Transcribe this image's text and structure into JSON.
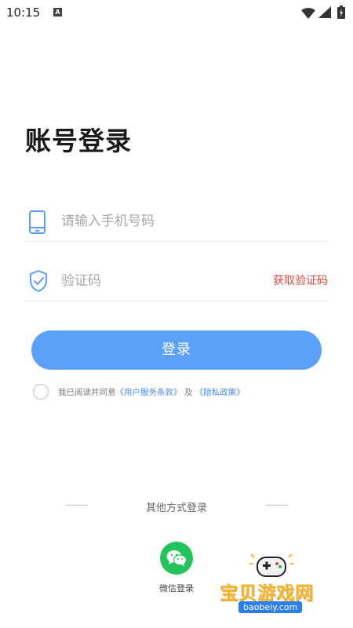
{
  "status_bar": {
    "time": "10:15",
    "notification_icon": "a-letter-icon",
    "icons": [
      "wifi-icon",
      "signal-icon",
      "battery-icon"
    ]
  },
  "page": {
    "title": "账号登录"
  },
  "phone_field": {
    "icon": "phone-icon",
    "placeholder": "请输入手机号码",
    "value": ""
  },
  "code_field": {
    "icon": "shield-check-icon",
    "placeholder": "验证码",
    "value": "",
    "get_code_label": "获取验证码"
  },
  "login_button": {
    "label": "登录"
  },
  "agreement": {
    "checked": false,
    "prefix": "我已阅读并同意",
    "terms_link": "《用户服务条款》",
    "conjunction": "及",
    "privacy_link": "《隐私政策》"
  },
  "other_login": {
    "label": "其他方式登录",
    "wechat_label": "微信登录"
  },
  "watermark": {
    "text": "宝贝游戏网",
    "url": "baobeiy.com"
  },
  "colors": {
    "primary": "#5ba1f9",
    "accent_red": "#e8483b",
    "link_blue": "#4a8ef0",
    "wechat_green": "#21c35a"
  }
}
